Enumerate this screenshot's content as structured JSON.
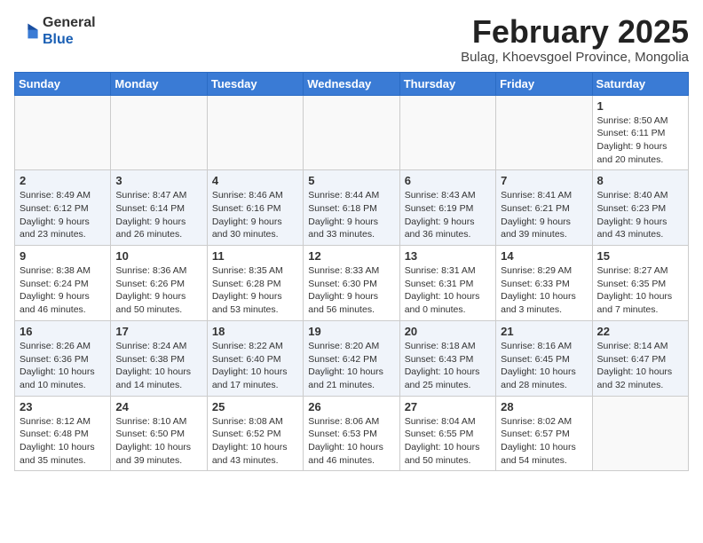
{
  "logo": {
    "general": "General",
    "blue": "Blue"
  },
  "title": "February 2025",
  "location": "Bulag, Khoevsgoel Province, Mongolia",
  "weekdays": [
    "Sunday",
    "Monday",
    "Tuesday",
    "Wednesday",
    "Thursday",
    "Friday",
    "Saturday"
  ],
  "weeks": [
    [
      {
        "day": "",
        "info": ""
      },
      {
        "day": "",
        "info": ""
      },
      {
        "day": "",
        "info": ""
      },
      {
        "day": "",
        "info": ""
      },
      {
        "day": "",
        "info": ""
      },
      {
        "day": "",
        "info": ""
      },
      {
        "day": "1",
        "info": "Sunrise: 8:50 AM\nSunset: 6:11 PM\nDaylight: 9 hours and 20 minutes."
      }
    ],
    [
      {
        "day": "2",
        "info": "Sunrise: 8:49 AM\nSunset: 6:12 PM\nDaylight: 9 hours and 23 minutes."
      },
      {
        "day": "3",
        "info": "Sunrise: 8:47 AM\nSunset: 6:14 PM\nDaylight: 9 hours and 26 minutes."
      },
      {
        "day": "4",
        "info": "Sunrise: 8:46 AM\nSunset: 6:16 PM\nDaylight: 9 hours and 30 minutes."
      },
      {
        "day": "5",
        "info": "Sunrise: 8:44 AM\nSunset: 6:18 PM\nDaylight: 9 hours and 33 minutes."
      },
      {
        "day": "6",
        "info": "Sunrise: 8:43 AM\nSunset: 6:19 PM\nDaylight: 9 hours and 36 minutes."
      },
      {
        "day": "7",
        "info": "Sunrise: 8:41 AM\nSunset: 6:21 PM\nDaylight: 9 hours and 39 minutes."
      },
      {
        "day": "8",
        "info": "Sunrise: 8:40 AM\nSunset: 6:23 PM\nDaylight: 9 hours and 43 minutes."
      }
    ],
    [
      {
        "day": "9",
        "info": "Sunrise: 8:38 AM\nSunset: 6:24 PM\nDaylight: 9 hours and 46 minutes."
      },
      {
        "day": "10",
        "info": "Sunrise: 8:36 AM\nSunset: 6:26 PM\nDaylight: 9 hours and 50 minutes."
      },
      {
        "day": "11",
        "info": "Sunrise: 8:35 AM\nSunset: 6:28 PM\nDaylight: 9 hours and 53 minutes."
      },
      {
        "day": "12",
        "info": "Sunrise: 8:33 AM\nSunset: 6:30 PM\nDaylight: 9 hours and 56 minutes."
      },
      {
        "day": "13",
        "info": "Sunrise: 8:31 AM\nSunset: 6:31 PM\nDaylight: 10 hours and 0 minutes."
      },
      {
        "day": "14",
        "info": "Sunrise: 8:29 AM\nSunset: 6:33 PM\nDaylight: 10 hours and 3 minutes."
      },
      {
        "day": "15",
        "info": "Sunrise: 8:27 AM\nSunset: 6:35 PM\nDaylight: 10 hours and 7 minutes."
      }
    ],
    [
      {
        "day": "16",
        "info": "Sunrise: 8:26 AM\nSunset: 6:36 PM\nDaylight: 10 hours and 10 minutes."
      },
      {
        "day": "17",
        "info": "Sunrise: 8:24 AM\nSunset: 6:38 PM\nDaylight: 10 hours and 14 minutes."
      },
      {
        "day": "18",
        "info": "Sunrise: 8:22 AM\nSunset: 6:40 PM\nDaylight: 10 hours and 17 minutes."
      },
      {
        "day": "19",
        "info": "Sunrise: 8:20 AM\nSunset: 6:42 PM\nDaylight: 10 hours and 21 minutes."
      },
      {
        "day": "20",
        "info": "Sunrise: 8:18 AM\nSunset: 6:43 PM\nDaylight: 10 hours and 25 minutes."
      },
      {
        "day": "21",
        "info": "Sunrise: 8:16 AM\nSunset: 6:45 PM\nDaylight: 10 hours and 28 minutes."
      },
      {
        "day": "22",
        "info": "Sunrise: 8:14 AM\nSunset: 6:47 PM\nDaylight: 10 hours and 32 minutes."
      }
    ],
    [
      {
        "day": "23",
        "info": "Sunrise: 8:12 AM\nSunset: 6:48 PM\nDaylight: 10 hours and 35 minutes."
      },
      {
        "day": "24",
        "info": "Sunrise: 8:10 AM\nSunset: 6:50 PM\nDaylight: 10 hours and 39 minutes."
      },
      {
        "day": "25",
        "info": "Sunrise: 8:08 AM\nSunset: 6:52 PM\nDaylight: 10 hours and 43 minutes."
      },
      {
        "day": "26",
        "info": "Sunrise: 8:06 AM\nSunset: 6:53 PM\nDaylight: 10 hours and 46 minutes."
      },
      {
        "day": "27",
        "info": "Sunrise: 8:04 AM\nSunset: 6:55 PM\nDaylight: 10 hours and 50 minutes."
      },
      {
        "day": "28",
        "info": "Sunrise: 8:02 AM\nSunset: 6:57 PM\nDaylight: 10 hours and 54 minutes."
      },
      {
        "day": "",
        "info": ""
      }
    ]
  ]
}
